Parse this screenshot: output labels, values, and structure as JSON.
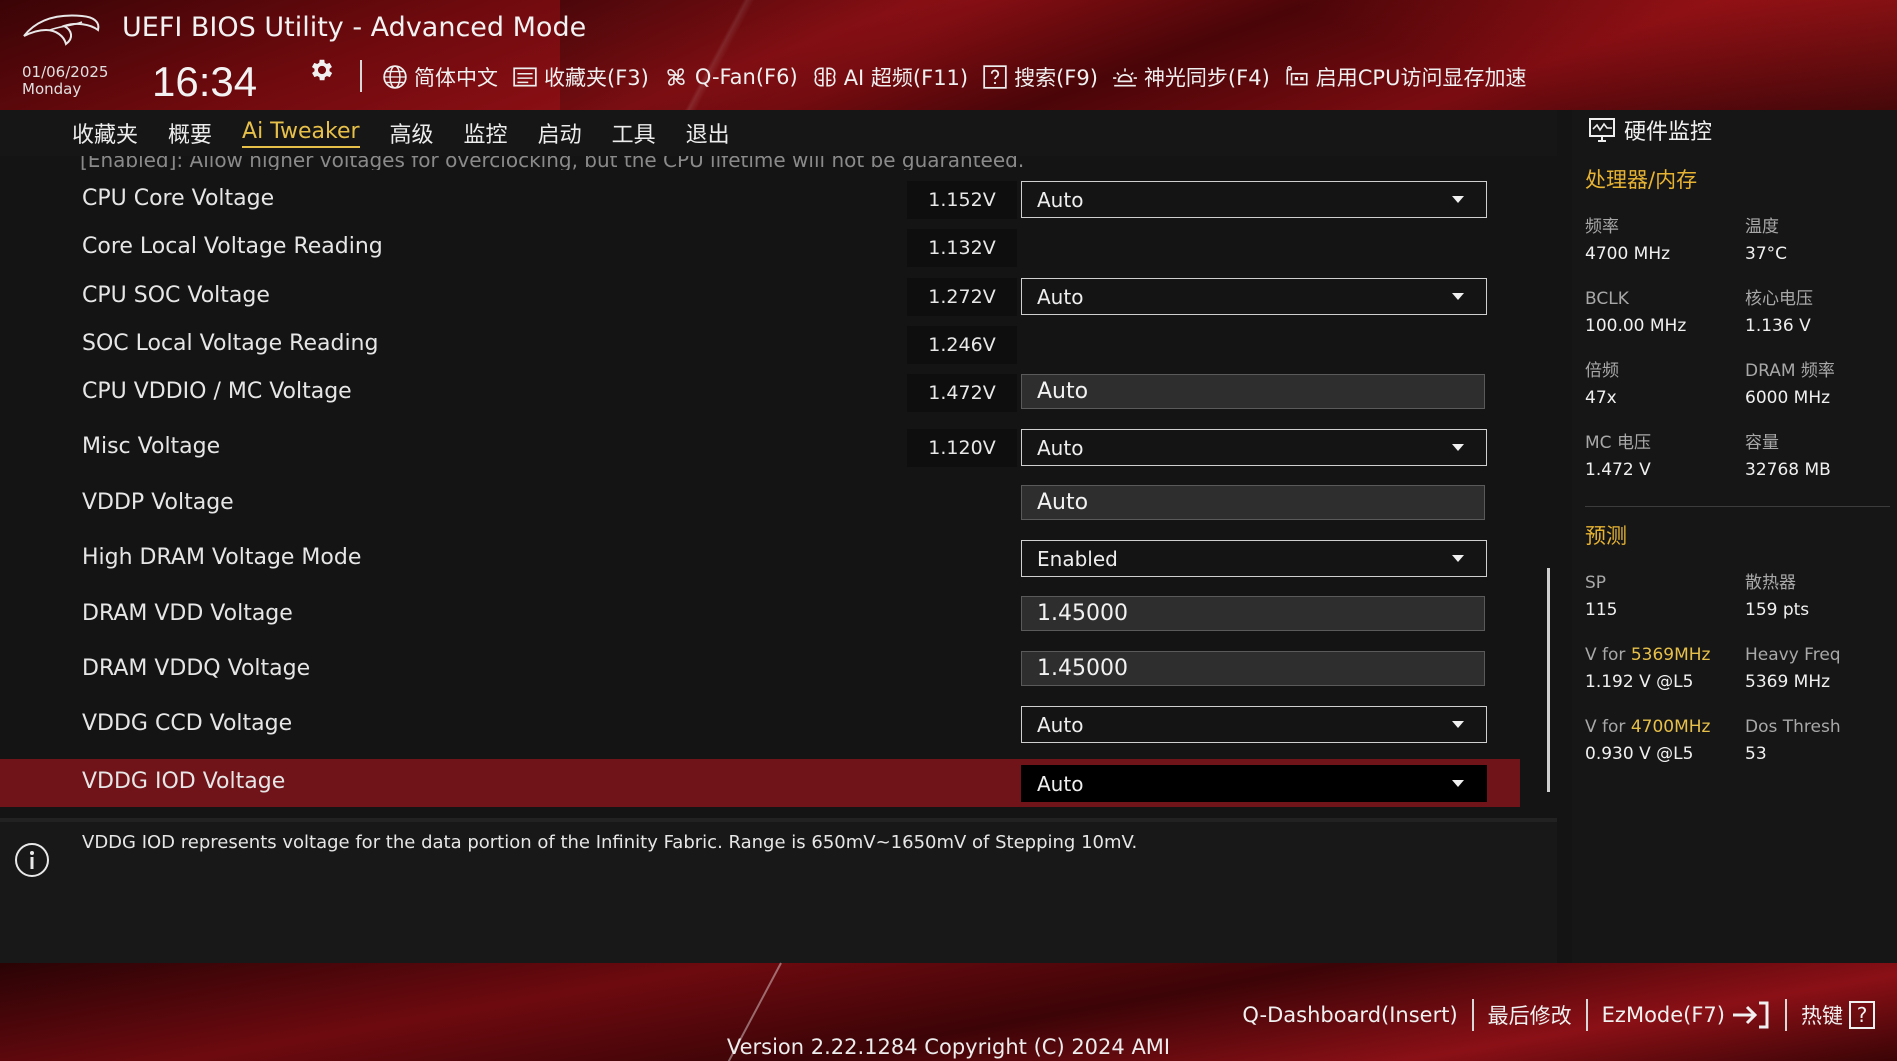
{
  "header": {
    "title": "UEFI BIOS Utility - Advanced Mode",
    "date": "01/06/2025",
    "weekday": "Monday",
    "time": "16:34",
    "tools": [
      {
        "label": "简体中文",
        "icon": "globe-icon"
      },
      {
        "label": "收藏夹(F3)",
        "icon": "favorites-list-icon"
      },
      {
        "label": "Q-Fan(F6)",
        "icon": "fan-icon"
      },
      {
        "label": "AI 超频(F11)",
        "icon": "ai-brain-icon"
      },
      {
        "label": "搜索(F9)",
        "icon": "help-search-icon"
      },
      {
        "label": "神光同步(F4)",
        "icon": "aura-sync-icon"
      },
      {
        "label": "启用CPU访问显存加速",
        "icon": "resizable-bar-icon"
      }
    ]
  },
  "nav": {
    "tabs": [
      "收藏夹",
      "概要",
      "Ai Tweaker",
      "高级",
      "监控",
      "启动",
      "工具",
      "退出"
    ],
    "active": "Ai Tweaker"
  },
  "main": {
    "cut_text": "[Enabled]: Allow higher voltages for overclocking, but the CPU lifetime will not be guaranteed.",
    "rows": [
      {
        "label": "CPU Core Voltage",
        "reading": "1.152V",
        "control": "select",
        "value": "Auto"
      },
      {
        "label": "Core Local Voltage Reading",
        "reading": "1.132V",
        "control": "none",
        "value": ""
      },
      {
        "label": "CPU SOC Voltage",
        "reading": "1.272V",
        "control": "select",
        "value": "Auto"
      },
      {
        "label": "SOC Local Voltage Reading",
        "reading": "1.246V",
        "control": "none",
        "value": ""
      },
      {
        "label": "CPU VDDIO / MC Voltage",
        "reading": "1.472V",
        "control": "field",
        "value": "Auto"
      },
      {
        "label": "Misc Voltage",
        "reading": "1.120V",
        "control": "select",
        "value": "Auto"
      },
      {
        "label": "VDDP Voltage",
        "reading": "",
        "control": "field",
        "value": "Auto"
      },
      {
        "label": "High DRAM Voltage Mode",
        "reading": "",
        "control": "select",
        "value": "Enabled"
      },
      {
        "label": "DRAM VDD Voltage",
        "reading": "",
        "control": "field",
        "value": "1.45000"
      },
      {
        "label": "DRAM VDDQ Voltage",
        "reading": "",
        "control": "field",
        "value": "1.45000"
      },
      {
        "label": "VDDG CCD Voltage",
        "reading": "",
        "control": "select",
        "value": "Auto"
      },
      {
        "label": "VDDG IOD Voltage",
        "reading": "",
        "control": "select",
        "value": "Auto",
        "selected": true
      }
    ]
  },
  "help": {
    "text": "VDDG IOD represents voltage for the data portion of the Infinity Fabric. Range is 650mV~1650mV of Stepping 10mV."
  },
  "monitor": {
    "title": "硬件监控",
    "cpu_mem_section": "处理器/内存",
    "cpu_mem": [
      {
        "k": "频率",
        "v": "4700 MHz"
      },
      {
        "k": "温度",
        "v": "37°C"
      },
      {
        "k": "BCLK",
        "v": "100.00 MHz"
      },
      {
        "k": "核心电压",
        "v": "1.136 V"
      },
      {
        "k": "倍频",
        "v": "47x"
      },
      {
        "k": "DRAM 频率",
        "v": "6000 MHz"
      },
      {
        "k": "MC 电压",
        "v": "1.472 V"
      },
      {
        "k": "容量",
        "v": "32768 MB"
      }
    ],
    "prediction_section": "预测",
    "prediction": [
      {
        "k": "SP",
        "v": "115"
      },
      {
        "k": "散热器",
        "v": "159 pts"
      },
      {
        "k_prefix": "V for ",
        "k_hl": "5369MHz",
        "v": "1.192 V @L5"
      },
      {
        "k": "Heavy Freq",
        "v": "5369 MHz"
      },
      {
        "k_prefix": "V for ",
        "k_hl": "4700MHz",
        "v": "0.930 V @L5"
      },
      {
        "k": "Dos Thresh",
        "v": "53"
      }
    ]
  },
  "footer": {
    "items": [
      "Q-Dashboard(Insert)",
      "最后修改",
      "EzMode(F7)",
      "热键"
    ],
    "hotkey_glyph": "?",
    "version": "Version 2.22.1284 Copyright (C) 2024 AMI"
  },
  "colors": {
    "accent": "#e7c04a",
    "section": "#e7b333",
    "selected_row": "#701419",
    "brand_red": "#8e1015"
  }
}
